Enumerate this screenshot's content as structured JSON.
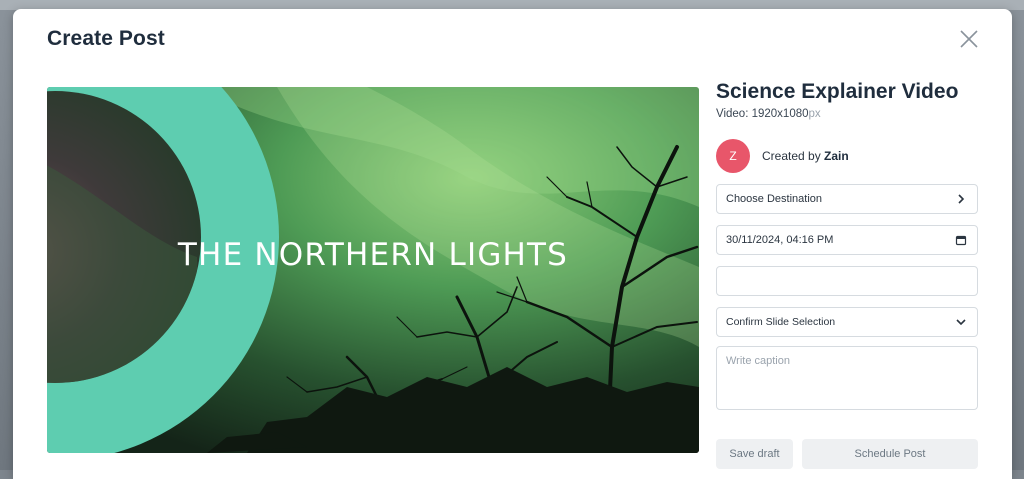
{
  "modal": {
    "title": "Create Post"
  },
  "preview": {
    "overlay_text": "THE NORTHERN LIGHTS",
    "accent_color": "#5ecdb0"
  },
  "details": {
    "title": "Science Explainer Video",
    "meta_prefix": "Video: 1920x1080",
    "meta_unit": "px",
    "avatar_initial": "Z",
    "avatar_color": "#e8566a",
    "created_by_label": "Created by",
    "creator_name": "Zain"
  },
  "form": {
    "destination_label": "Choose Destination",
    "datetime_value": "30/11/2024, 04:16 PM",
    "blank_field_value": "",
    "slide_select_label": "Confirm Slide Selection",
    "caption_placeholder": "Write caption"
  },
  "actions": {
    "save_label": "Save draft",
    "schedule_label": "Schedule Post"
  }
}
